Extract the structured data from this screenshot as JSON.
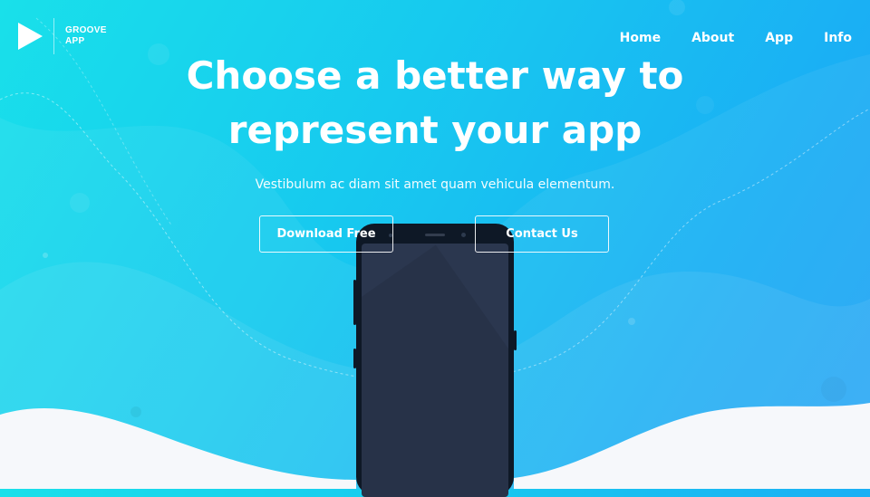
{
  "logo": {
    "line1": "GROOVE",
    "line2": "APP",
    "icon": "play-icon"
  },
  "nav": {
    "items": [
      "Home",
      "About",
      "App",
      "Info"
    ]
  },
  "hero": {
    "title_line1": "Choose a better way to",
    "title_line2": "represent your app",
    "subtitle": "Vestibulum ac diam sit amet quam vehicula elementum."
  },
  "buttons": {
    "download": "Download Free",
    "contact": "Contact Us"
  },
  "colors": {
    "accent_start": "#19e0ea",
    "accent_end": "#24a2f5",
    "phone_body": "#0e1826",
    "phone_screen": "#2b374f",
    "footer_bg": "#f6f8fb"
  }
}
